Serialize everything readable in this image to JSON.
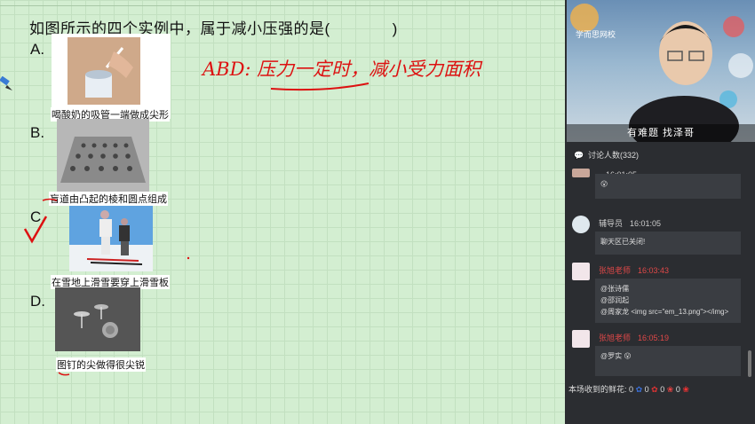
{
  "question": "如图所示的四个实例中，属于减小压强的是(　　　　)",
  "options": [
    {
      "letter": "A.",
      "caption": "喝酸奶的吸管一端做成尖形"
    },
    {
      "letter": "B.",
      "caption": "盲道由凸起的棱和圆点组成"
    },
    {
      "letter": "C.",
      "caption": "在雪地上滑雪要穿上滑雪板"
    },
    {
      "letter": "D.",
      "caption": "图钉的尖做得很尖锐"
    }
  ],
  "answer": "ABD: 压力一定时，减小受力面积",
  "video": {
    "caption": "有难题 找泽哥",
    "logo": "学而思网校"
  },
  "discussion": {
    "header": "讨论人数(332)"
  },
  "messages": [
    {
      "name": "",
      "time": "16:01:05",
      "text": "😮"
    },
    {
      "name": "辅导员",
      "time": "16:01:05",
      "text": "聊天区已关闭!"
    },
    {
      "name": "张旭老师",
      "time": "16:03:43",
      "lines": [
        "@张诗儒",
        "@邵润起",
        "@周家龙 <img src=\"em_13.png\"></img>"
      ]
    },
    {
      "name": "张旭老师",
      "time": "16:05:19",
      "text": "@罗实 😮"
    }
  ],
  "flowers": {
    "label": "本场收到的鲜花:",
    "counts": [
      "0",
      "0",
      "0",
      "0"
    ]
  },
  "colors": {
    "answer_red": "#dd1111",
    "teacher_red": "#e04848",
    "board_green": "#d3eed1"
  }
}
